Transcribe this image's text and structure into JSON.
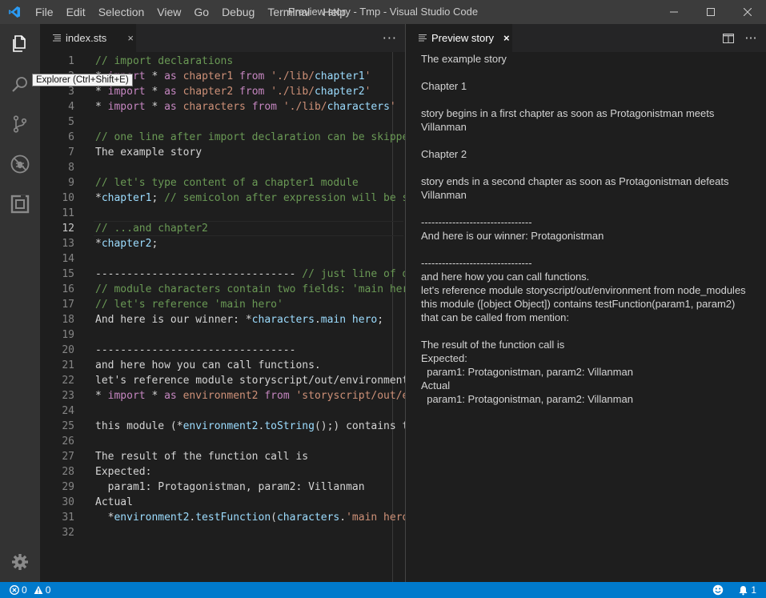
{
  "titlebar": {
    "menu": [
      "File",
      "Edit",
      "Selection",
      "View",
      "Go",
      "Debug",
      "Terminal",
      "Help"
    ],
    "title": "Preview story - Tmp - Visual Studio Code",
    "app_icon": "vscode-logo-icon",
    "controls": [
      "minimize-icon",
      "maximize-icon",
      "close-icon"
    ]
  },
  "activitybar": {
    "icons": [
      "explorer-files-icon",
      "search-icon",
      "source-control-icon",
      "debug-icon",
      "extensions-icon"
    ],
    "bottom_icon": "gear-icon",
    "tooltip": "Explorer (Ctrl+Shift+E)"
  },
  "editor": {
    "tab": {
      "label": "index.sts",
      "close": "×",
      "icon": "file-lines-icon"
    },
    "more": "···",
    "active_line": 12,
    "lines": [
      {
        "n": 1,
        "t": [
          [
            "c-com",
            "// import declarations"
          ]
        ]
      },
      {
        "n": 2,
        "t": [
          [
            "c-plain",
            "* "
          ],
          [
            "c-kw",
            "import"
          ],
          [
            "c-plain",
            " * "
          ],
          [
            "c-kw",
            "as"
          ],
          [
            "c-plain",
            " "
          ],
          [
            "c-str",
            "chapter1"
          ],
          [
            "c-plain",
            " "
          ],
          [
            "c-kw",
            "from"
          ],
          [
            "c-plain",
            " "
          ],
          [
            "c-str",
            "'./lib/"
          ],
          [
            "c-var",
            "chapter1"
          ],
          [
            "c-str",
            "'"
          ]
        ]
      },
      {
        "n": 3,
        "t": [
          [
            "c-plain",
            "* "
          ],
          [
            "c-kw",
            "import"
          ],
          [
            "c-plain",
            " * "
          ],
          [
            "c-kw",
            "as"
          ],
          [
            "c-plain",
            " "
          ],
          [
            "c-str",
            "chapter2"
          ],
          [
            "c-plain",
            " "
          ],
          [
            "c-kw",
            "from"
          ],
          [
            "c-plain",
            " "
          ],
          [
            "c-str",
            "'./lib/"
          ],
          [
            "c-var",
            "chapter2"
          ],
          [
            "c-str",
            "'"
          ]
        ]
      },
      {
        "n": 4,
        "t": [
          [
            "c-plain",
            "* "
          ],
          [
            "c-kw",
            "import"
          ],
          [
            "c-plain",
            " * "
          ],
          [
            "c-kw",
            "as"
          ],
          [
            "c-plain",
            " "
          ],
          [
            "c-str",
            "characters"
          ],
          [
            "c-plain",
            " "
          ],
          [
            "c-kw",
            "from"
          ],
          [
            "c-plain",
            " "
          ],
          [
            "c-str",
            "'./lib/"
          ],
          [
            "c-var",
            "characters"
          ],
          [
            "c-str",
            "'"
          ]
        ]
      },
      {
        "n": 5,
        "t": []
      },
      {
        "n": 6,
        "t": [
          [
            "c-com",
            "// one line after import declaration can be skippe"
          ]
        ]
      },
      {
        "n": 7,
        "t": [
          [
            "c-plain",
            "The example story"
          ]
        ]
      },
      {
        "n": 8,
        "t": []
      },
      {
        "n": 9,
        "t": [
          [
            "c-com",
            "// let's type content of a chapter1 module"
          ]
        ]
      },
      {
        "n": 10,
        "t": [
          [
            "c-plain",
            "*"
          ],
          [
            "c-var",
            "chapter1"
          ],
          [
            "c-plain",
            "; "
          ],
          [
            "c-com",
            "// semicolon after expression will be s"
          ]
        ]
      },
      {
        "n": 11,
        "t": []
      },
      {
        "n": 12,
        "t": [
          [
            "c-com",
            "// ...and chapter2"
          ]
        ]
      },
      {
        "n": 13,
        "t": [
          [
            "c-plain",
            "*"
          ],
          [
            "c-var",
            "chapter2"
          ],
          [
            "c-plain",
            ";"
          ]
        ]
      },
      {
        "n": 14,
        "t": []
      },
      {
        "n": 15,
        "t": [
          [
            "c-plain",
            "-------------------------------- "
          ],
          [
            "c-com",
            "// just line of d"
          ]
        ]
      },
      {
        "n": 16,
        "t": [
          [
            "c-com",
            "// module characters contain two fields: 'main her"
          ]
        ]
      },
      {
        "n": 17,
        "t": [
          [
            "c-com",
            "// let's reference 'main hero'"
          ]
        ]
      },
      {
        "n": 18,
        "t": [
          [
            "c-plain",
            "And here is our winner: *"
          ],
          [
            "c-var",
            "characters"
          ],
          [
            "c-plain",
            "."
          ],
          [
            "c-var",
            "main hero"
          ],
          [
            "c-plain",
            ";"
          ]
        ]
      },
      {
        "n": 19,
        "t": []
      },
      {
        "n": 20,
        "t": [
          [
            "c-plain",
            "--------------------------------"
          ]
        ]
      },
      {
        "n": 21,
        "t": [
          [
            "c-plain",
            "and here how you can call functions."
          ]
        ]
      },
      {
        "n": 22,
        "t": [
          [
            "c-plain",
            "let's reference module storyscript/out/environment"
          ]
        ]
      },
      {
        "n": 23,
        "t": [
          [
            "c-plain",
            "* "
          ],
          [
            "c-kw",
            "import"
          ],
          [
            "c-plain",
            " * "
          ],
          [
            "c-kw",
            "as"
          ],
          [
            "c-plain",
            " "
          ],
          [
            "c-str",
            "environment2"
          ],
          [
            "c-plain",
            " "
          ],
          [
            "c-kw",
            "from"
          ],
          [
            "c-plain",
            " "
          ],
          [
            "c-str",
            "'storyscript/out/e"
          ]
        ]
      },
      {
        "n": 24,
        "t": []
      },
      {
        "n": 25,
        "t": [
          [
            "c-plain",
            "this module (*"
          ],
          [
            "c-var",
            "environment2"
          ],
          [
            "c-plain",
            "."
          ],
          [
            "c-var",
            "toString"
          ],
          [
            "c-plain",
            "();) contains te"
          ]
        ]
      },
      {
        "n": 26,
        "t": []
      },
      {
        "n": 27,
        "t": [
          [
            "c-plain",
            "The result of the function call is"
          ]
        ]
      },
      {
        "n": 28,
        "t": [
          [
            "c-plain",
            "Expected:"
          ]
        ]
      },
      {
        "n": 29,
        "t": [
          [
            "c-plain",
            "  param1: Protagonistman, param2: Villanman"
          ]
        ]
      },
      {
        "n": 30,
        "t": [
          [
            "c-plain",
            "Actual"
          ]
        ]
      },
      {
        "n": 31,
        "t": [
          [
            "c-plain",
            "  *"
          ],
          [
            "c-var",
            "environment2"
          ],
          [
            "c-plain",
            "."
          ],
          [
            "c-var",
            "testFunction"
          ],
          [
            "c-plain",
            "("
          ],
          [
            "c-var",
            "characters"
          ],
          [
            "c-plain",
            "."
          ],
          [
            "c-str",
            "'main hero"
          ]
        ]
      },
      {
        "n": 32,
        "t": []
      }
    ]
  },
  "preview": {
    "tab": {
      "label": "Preview story",
      "close": "×",
      "icon": "preview-lines-icon"
    },
    "actions": [
      "split-editor-icon",
      "more-actions-icon"
    ],
    "more": "···",
    "lines": [
      "The example story",
      "",
      "Chapter 1",
      "",
      "story begins in a first chapter as soon as Protagonistman meets",
      "Villanman",
      "",
      "Chapter 2",
      "",
      "story ends in a second chapter as soon as Protagonistman defeats",
      "Villanman",
      "",
      "--------------------------------",
      "And here is our winner: Protagonistman",
      "",
      "--------------------------------",
      "and here how you can call functions.",
      "let's reference module storyscript/out/environment from node_modules",
      "this module ([object Object]) contains testFunction(param1, param2)",
      "that can be called from mention:",
      "",
      "The result of the function call is",
      "Expected:",
      "  param1: Protagonistman, param2: Villanman",
      "Actual",
      "  param1: Protagonistman, param2: Villanman"
    ]
  },
  "statusbar": {
    "errors": "0",
    "warnings": "0",
    "notifications": "1",
    "feedback_icon": "smiley-icon",
    "bell_icon": "bell-icon",
    "color": "#007acc"
  }
}
